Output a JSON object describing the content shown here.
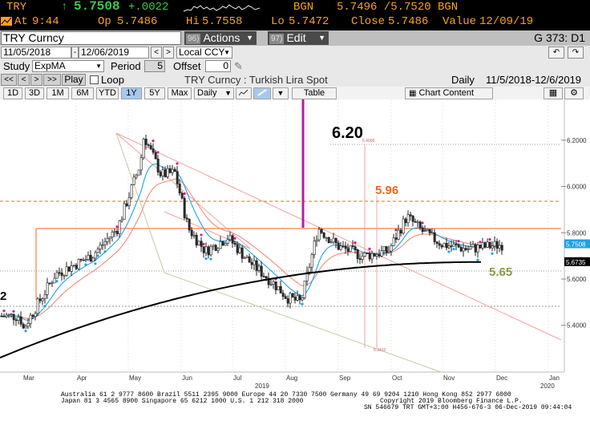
{
  "quote": {
    "ticker": "TRY",
    "arrow": "↑",
    "last": "5.7508",
    "change": "+.0022",
    "source1": "BGN",
    "bid_ask": "5.7496 /5.7520",
    "source2": "BGN",
    "time_prefix": "At",
    "time": "9:44",
    "open_label": "Op",
    "open": "5.7486",
    "high_label": "Hi",
    "high": "5.7558",
    "low_label": "Lo",
    "low": "5.7472",
    "close_label": "Close",
    "close": "5.7486",
    "value_label": "Value",
    "value_date": "12/09/19"
  },
  "title_bar": {
    "ticker_field": "TRY Curncy",
    "actions_num": "96)",
    "actions_label": "Actions",
    "edit_num": "97)",
    "edit_label": "Edit",
    "page_id": "G 373: D1"
  },
  "controls": {
    "start_date": "11/05/2018",
    "end_date": "12/06/2019",
    "prev": "<",
    "next": ">",
    "currency": "Local CCY",
    "study_label": "Study",
    "study_value": "ExpMA",
    "period_label": "Period",
    "period_value": "5",
    "offset_label": "Offset",
    "offset_value": "0",
    "play": {
      "first": "<<",
      "prev": "<",
      "next": ">",
      "last": ">>",
      "play": "Play",
      "loop": "Loop"
    },
    "chart_title": "TRY Curncy : Turkish Lira Spot",
    "frequency": "Daily",
    "range_text": "11/5/2018-12/6/2019",
    "periods": [
      "1D",
      "3D",
      "1M",
      "6M",
      "YTD",
      "1Y",
      "5Y",
      "Max"
    ],
    "active_period": "1Y",
    "freq_select": "Daily",
    "table_btn": "Table",
    "chart_content_btn": "Chart Content"
  },
  "chart_data": {
    "type": "line",
    "title": "TRY Curncy : Turkish Lira Spot",
    "xlabel": "",
    "ylabel": "",
    "ylim": [
      5.25,
      6.3
    ],
    "y_ticks": [
      "6.2000",
      "6.0000",
      "5.8000",
      "5.6000",
      "5.4000"
    ],
    "x_ticks": [
      "Mar",
      "Apr",
      "May",
      "Jun",
      "Jul",
      "Aug",
      "Sep",
      "Oct",
      "Nov",
      "Dec",
      "Jan"
    ],
    "x_year_labels": [
      "2019",
      "2020"
    ],
    "last_value_label": "5.7508",
    "ma_value_label": "5.6735",
    "annotations": [
      {
        "text": "6.20",
        "color": "#000000"
      },
      {
        "text": "5.96",
        "color": "#f26522"
      },
      {
        "text": "5.65",
        "color": "#8a9a3a"
      },
      {
        "text": "2",
        "color": "#000000"
      }
    ],
    "small_labels": [
      "6.4006",
      "5.3432"
    ],
    "series": [
      {
        "name": "",
        "color": "#1aa3e8"
      },
      {
        "name": "",
        "color": "#000000"
      }
    ],
    "price_points": [
      {
        "x": "Feb 15",
        "y": 5.44
      },
      {
        "x": "Mar 1",
        "y": 5.38
      },
      {
        "x": "Mar 20",
        "y": 5.62
      },
      {
        "x": "Apr 10",
        "y": 5.7
      },
      {
        "x": "Apr 25",
        "y": 5.82
      },
      {
        "x": "May 8",
        "y": 6.1
      },
      {
        "x": "May 10",
        "y": 6.22
      },
      {
        "x": "May 20",
        "y": 6.05
      },
      {
        "x": "May 28",
        "y": 6.06
      },
      {
        "x": "Jun 5",
        "y": 5.82
      },
      {
        "x": "Jun 15",
        "y": 5.72
      },
      {
        "x": "Jun 28",
        "y": 5.78
      },
      {
        "x": "Jul 10",
        "y": 5.68
      },
      {
        "x": "Jul 25",
        "y": 5.58
      },
      {
        "x": "Aug 2",
        "y": 5.52
      },
      {
        "x": "Aug 10",
        "y": 5.5
      },
      {
        "x": "Aug 20",
        "y": 5.82
      },
      {
        "x": "Sep 1",
        "y": 5.74
      },
      {
        "x": "Sep 15",
        "y": 5.7
      },
      {
        "x": "Sep 30",
        "y": 5.72
      },
      {
        "x": "Oct 10",
        "y": 5.87
      },
      {
        "x": "Oct 20",
        "y": 5.8
      },
      {
        "x": "Nov 1",
        "y": 5.75
      },
      {
        "x": "Nov 15",
        "y": 5.73
      },
      {
        "x": "Dec 6",
        "y": 5.75
      }
    ]
  },
  "footer": {
    "line1": "Australia 61 2 9777 8600 Brazil 5511 2395 9000 Europe 44 20 7330 7500 Germany 49 69 9204 1210 Hong Kong 852 2977 6000",
    "line2": "Japan 81 3 4565 8900       Singapore 65 6212 1000       U.S. 1 212 318 2000",
    "copyright": "Copyright 2019 Bloomberg Finance L.P.",
    "stamp": "SN 546679 TRT  GMT+3:00 H456-676-3 06-Dec-2019 09:44:04"
  }
}
